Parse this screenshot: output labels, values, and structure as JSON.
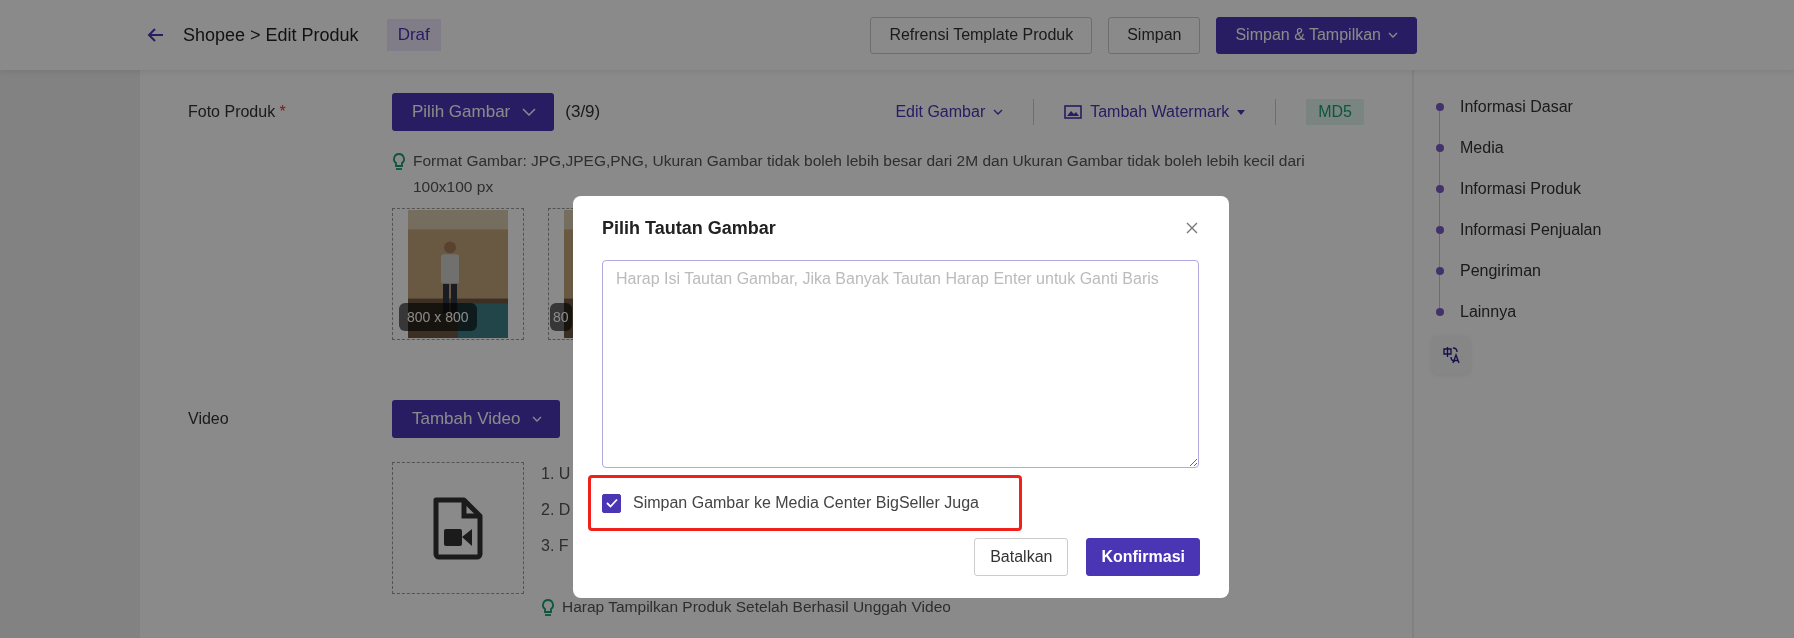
{
  "header": {
    "breadcrumb": "Shopee > Edit Produk",
    "status_badge": "Draf",
    "buttons": [
      {
        "label": "Refrensi Template Produk",
        "kind": "outline",
        "dropdown": false
      },
      {
        "label": "Simpan",
        "kind": "outline",
        "dropdown": false
      },
      {
        "label": "Simpan & Tampilkan",
        "kind": "primary",
        "dropdown": true
      }
    ]
  },
  "photo_section": {
    "label": "Foto Produk",
    "required_mark": "*",
    "pick_button": "Pilih Gambar",
    "count": "(3/9)",
    "edit_menu": "Edit Gambar",
    "watermark_menu": "Tambah Watermark",
    "md5_badge": "MD5",
    "hint": "Format Gambar: JPG,JPEG,PNG, Ukuran Gambar tidak boleh lebih besar dari 2M dan Ukuran Gambar tidak boleh lebih kecil dari 100x100 px",
    "images": [
      {
        "kind": "picture",
        "size": "800 x 800"
      },
      {
        "kind": "picture",
        "size": "80"
      }
    ]
  },
  "video_section": {
    "label": "Video",
    "add_button": "Tambah Video",
    "steps": [
      "1. U",
      "2. D",
      "3. F"
    ],
    "hint": "Harap Tampilkan Produk Setelah Berhasil Unggah Video"
  },
  "section_nav": {
    "items": [
      "Informasi Dasar",
      "Media",
      "Informasi Produk",
      "Informasi Penjualan",
      "Pengiriman",
      "Lainnya"
    ]
  },
  "dialog": {
    "title": "Pilih Tautan Gambar",
    "placeholder": "Harap Isi Tautan Gambar, Jika Banyak Tautan Harap Enter untuk Ganti Baris",
    "checkbox": {
      "label": "Simpan Gambar ke Media Center BigSeller Juga",
      "checked": true
    },
    "buttons": [
      {
        "label": "Batalkan",
        "kind": "secondary"
      },
      {
        "label": "Konfirmasi",
        "kind": "primary"
      }
    ]
  }
}
